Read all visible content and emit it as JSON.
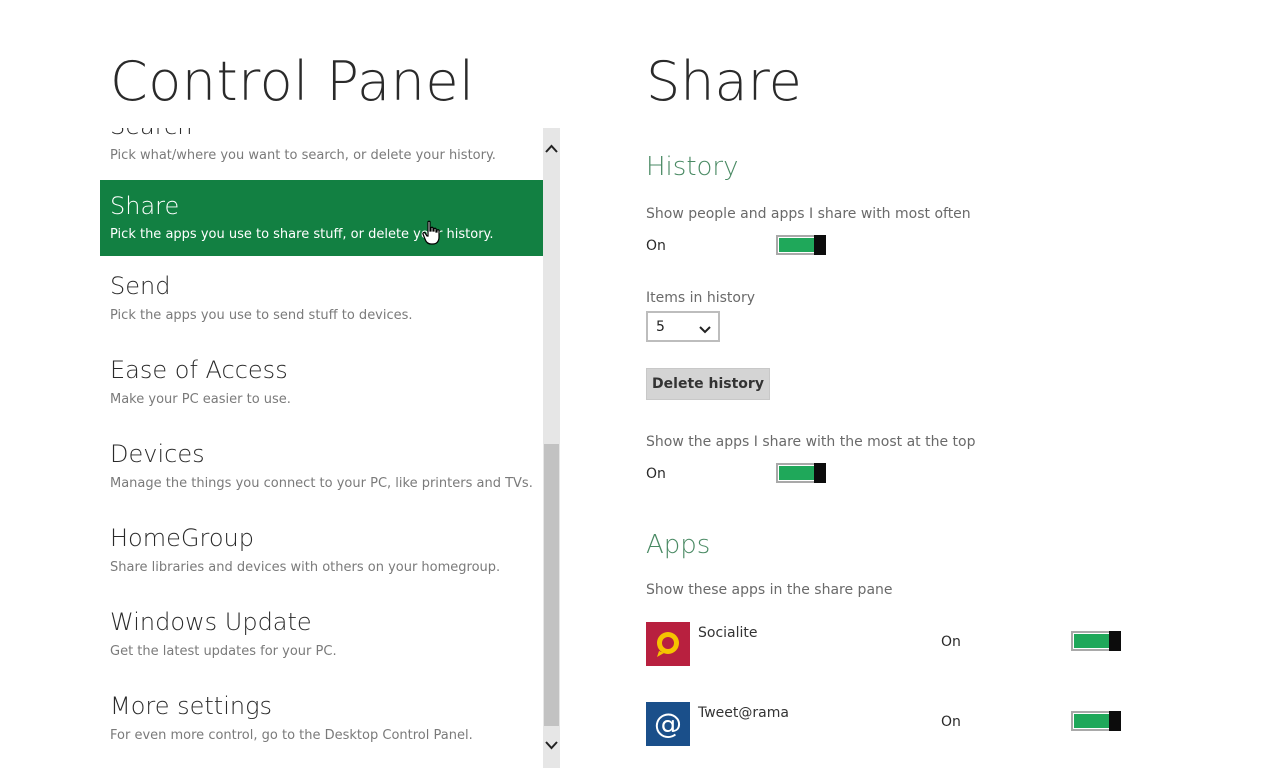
{
  "left": {
    "title": "Control Panel",
    "items": [
      {
        "name": "Search",
        "desc": "Pick what/where you want to search, or delete your history."
      },
      {
        "name": "Share",
        "desc": "Pick the apps you use to share stuff, or delete your history."
      },
      {
        "name": "Send",
        "desc": "Pick the apps you use to send stuff to devices."
      },
      {
        "name": "Ease of Access",
        "desc": "Make your PC easier to use."
      },
      {
        "name": "Devices",
        "desc": "Manage the things you connect to your PC, like printers and TVs."
      },
      {
        "name": "HomeGroup",
        "desc": "Share libraries and devices with others on your homegroup."
      },
      {
        "name": "Windows Update",
        "desc": "Get the latest updates for your PC."
      },
      {
        "name": "More settings",
        "desc": "For even more control, go to the Desktop Control Panel."
      }
    ],
    "selected_index": 1
  },
  "right": {
    "title": "Share",
    "history": {
      "heading": "History",
      "show_people_label": "Show people and apps I share with most often",
      "show_people_state": "On",
      "items_label": "Items in history",
      "items_value": "5",
      "delete_button": "Delete history",
      "show_top_label": "Show the apps I share with the most at the top",
      "show_top_state": "On"
    },
    "apps": {
      "heading": "Apps",
      "subtitle": "Show these apps in the share pane",
      "list": [
        {
          "name": "Socialite",
          "state": "On",
          "tile_color": "#b8203f",
          "icon": "socialite-icon"
        },
        {
          "name": "Tweet@rama",
          "state": "On",
          "tile_color": "#1a4f8a",
          "icon": "at-sign-icon"
        }
      ]
    }
  },
  "colors": {
    "accent_green": "#128042",
    "toggle_on": "#1fa85a",
    "heading_green": "#4a8a64"
  }
}
